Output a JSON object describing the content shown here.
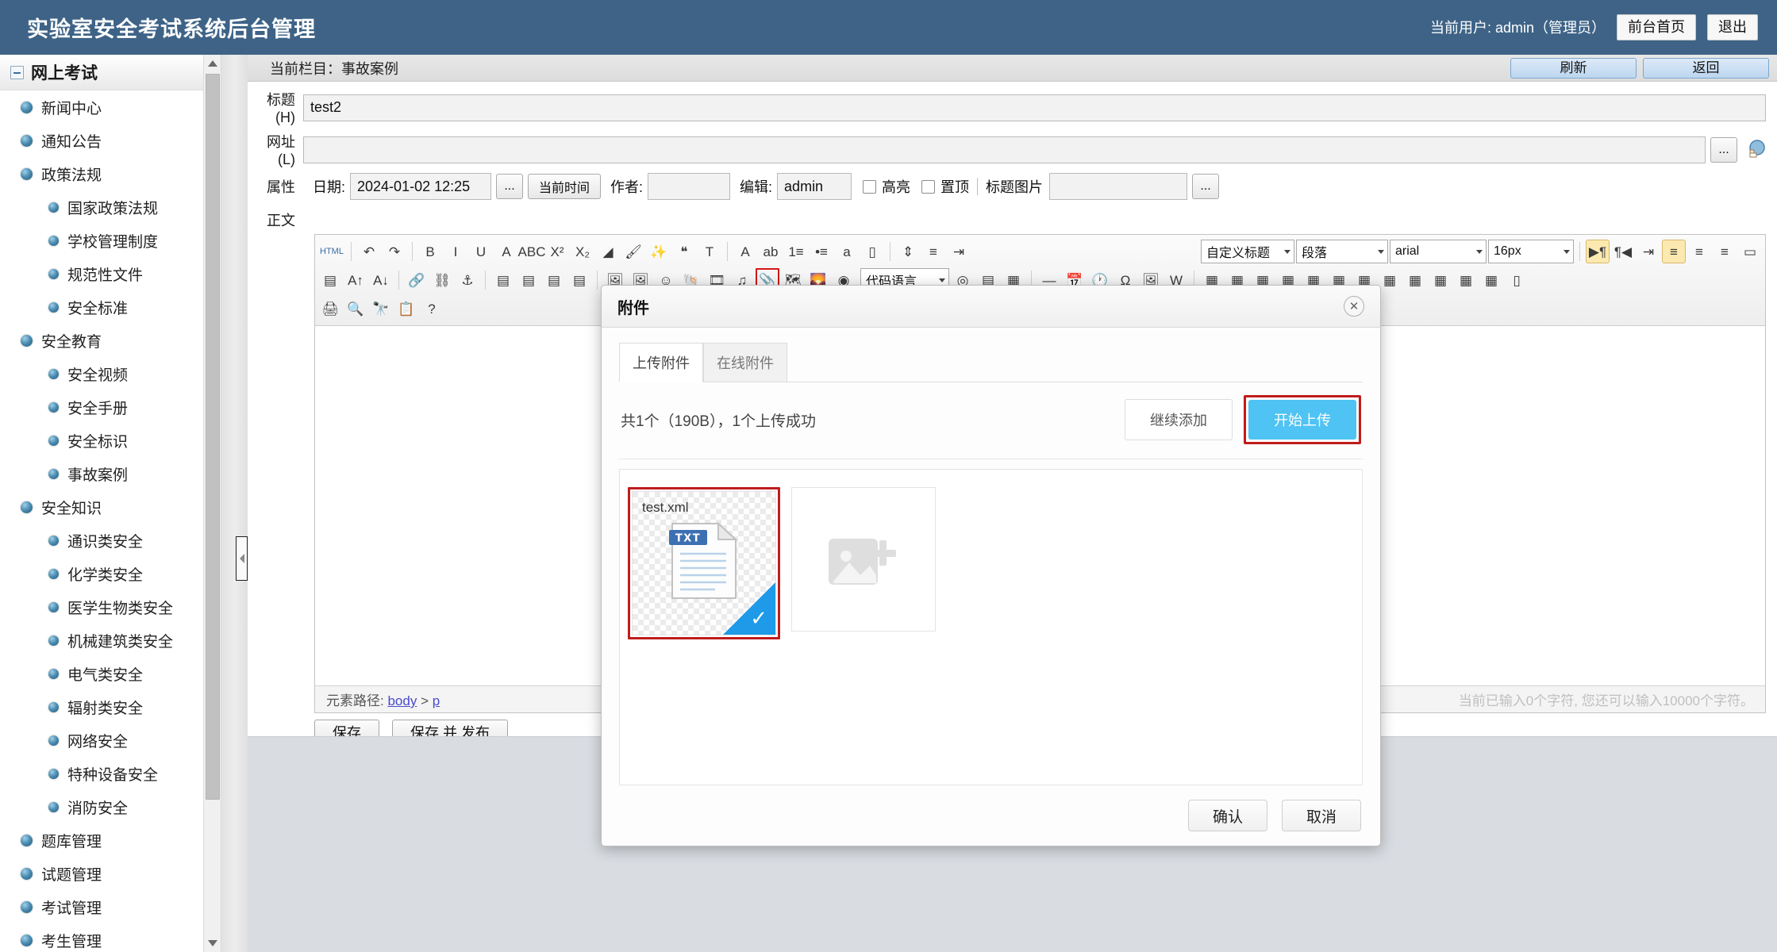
{
  "header": {
    "title": "实验室安全考试系统后台管理",
    "current_user": "当前用户: admin（管理员）",
    "frontend_button": "前台首页",
    "logout_button": "退出",
    "background_color": "#3e6387"
  },
  "sidebar": {
    "root_label": "网上考试",
    "items": [
      {
        "label": "新闻中心",
        "level": 1
      },
      {
        "label": "通知公告",
        "level": 1
      },
      {
        "label": "政策法规",
        "level": 1
      },
      {
        "label": "国家政策法规",
        "level": 2
      },
      {
        "label": "学校管理制度",
        "level": 2
      },
      {
        "label": "规范性文件",
        "level": 2
      },
      {
        "label": "安全标准",
        "level": 2
      },
      {
        "label": "安全教育",
        "level": 1
      },
      {
        "label": "安全视频",
        "level": 2
      },
      {
        "label": "安全手册",
        "level": 2
      },
      {
        "label": "安全标识",
        "level": 2
      },
      {
        "label": "事故案例",
        "level": 2
      },
      {
        "label": "安全知识",
        "level": 1
      },
      {
        "label": "通识类安全",
        "level": 2
      },
      {
        "label": "化学类安全",
        "level": 2
      },
      {
        "label": "医学生物类安全",
        "level": 2
      },
      {
        "label": "机械建筑类安全",
        "level": 2
      },
      {
        "label": "电气类安全",
        "level": 2
      },
      {
        "label": "辐射类安全",
        "level": 2
      },
      {
        "label": "网络安全",
        "level": 2
      },
      {
        "label": "特种设备安全",
        "level": 2
      },
      {
        "label": "消防安全",
        "level": 2
      },
      {
        "label": "题库管理",
        "level": 1
      },
      {
        "label": "试题管理",
        "level": 1
      },
      {
        "label": "考试管理",
        "level": 1
      },
      {
        "label": "考生管理",
        "level": 1
      }
    ]
  },
  "breadcrumb": {
    "text": "当前栏目：事故案例",
    "refresh_button": "刷新",
    "back_button": "返回"
  },
  "form": {
    "title_label": "标题(H)",
    "title_value": "test2",
    "url_label": "网址(L)",
    "url_value": "",
    "url_browse_button": "...",
    "attr_label": "属性",
    "date_label": "日期:",
    "date_value": "2024-01-02 12:25",
    "date_browse_button": "...",
    "now_button": "当前时间",
    "author_label": "作者:",
    "author_value": "",
    "editor_label": "编辑:",
    "editor_value": "admin",
    "highlight_label": "高亮",
    "top_label": "置顶",
    "title_image_label": "标题图片",
    "title_image_value": "",
    "title_image_browse_button": "...",
    "content_label": "正文"
  },
  "editor": {
    "toolbar_row1": [
      {
        "name": "html-source",
        "glyph": "HTML"
      },
      {
        "name": "sep"
      },
      {
        "name": "undo",
        "glyph": "↶"
      },
      {
        "name": "redo",
        "glyph": "↷"
      },
      {
        "name": "sep"
      },
      {
        "name": "bold",
        "glyph": "B"
      },
      {
        "name": "italic",
        "glyph": "I"
      },
      {
        "name": "underline",
        "glyph": "U"
      },
      {
        "name": "border",
        "glyph": "A"
      },
      {
        "name": "strikethrough",
        "glyph": "ABC"
      },
      {
        "name": "superscript",
        "glyph": "X²"
      },
      {
        "name": "subscript",
        "glyph": "X₂"
      },
      {
        "name": "remove-format",
        "glyph": "◢"
      },
      {
        "name": "paint-format",
        "glyph": "🖌"
      },
      {
        "name": "auto-format",
        "glyph": "✨"
      },
      {
        "name": "blockquote",
        "glyph": "❝"
      },
      {
        "name": "paste-text",
        "glyph": "T"
      },
      {
        "name": "sep"
      },
      {
        "name": "font-color",
        "glyph": "A"
      },
      {
        "name": "back-color",
        "glyph": "ab"
      },
      {
        "name": "ordered-list",
        "glyph": "1≡"
      },
      {
        "name": "unordered-list",
        "glyph": "•≡"
      },
      {
        "name": "anchor-link",
        "glyph": "a"
      },
      {
        "name": "page-break",
        "glyph": "▯"
      },
      {
        "name": "sep"
      },
      {
        "name": "line-height",
        "glyph": "⇕"
      },
      {
        "name": "paragraph-spacing",
        "glyph": "≡"
      },
      {
        "name": "indent-spacing",
        "glyph": "⇥"
      }
    ],
    "select_heading": "自定义标题",
    "select_paragraph": "段落",
    "select_font": "arial",
    "select_fontsize": "16px",
    "toolbar_row1_right": [
      {
        "name": "direction-ltr",
        "glyph": "▶¶",
        "active": true
      },
      {
        "name": "direction-rtl",
        "glyph": "¶◀"
      },
      {
        "name": "indent",
        "glyph": "⇥"
      },
      {
        "name": "align-left",
        "glyph": "≡",
        "active": true
      },
      {
        "name": "align-center",
        "glyph": "≡"
      },
      {
        "name": "align-right",
        "glyph": "≡"
      },
      {
        "name": "fullscreen",
        "glyph": "▭"
      }
    ],
    "toolbar_row2": [
      {
        "name": "justify",
        "glyph": "▤"
      },
      {
        "name": "increase-font",
        "glyph": "A↑"
      },
      {
        "name": "decrease-font",
        "glyph": "A↓"
      },
      {
        "name": "sep"
      },
      {
        "name": "insert-link",
        "glyph": "🔗"
      },
      {
        "name": "unlink",
        "glyph": "⛓"
      },
      {
        "name": "anchor",
        "glyph": "⚓"
      },
      {
        "name": "sep"
      },
      {
        "name": "image-left",
        "glyph": "▤"
      },
      {
        "name": "image-right",
        "glyph": "▤"
      },
      {
        "name": "image-center",
        "glyph": "▤"
      },
      {
        "name": "image-none",
        "glyph": "▤"
      },
      {
        "name": "sep"
      },
      {
        "name": "insert-image",
        "glyph": "🖼"
      },
      {
        "name": "image-manager",
        "glyph": "🖼"
      },
      {
        "name": "emotion",
        "glyph": "☺"
      },
      {
        "name": "seachart",
        "glyph": "🐚"
      },
      {
        "name": "insert-video",
        "glyph": "🎞"
      },
      {
        "name": "insert-music",
        "glyph": "♫"
      },
      {
        "name": "attachment",
        "glyph": "📎",
        "highlight": true
      },
      {
        "name": "map",
        "glyph": "🗺"
      },
      {
        "name": "gmap",
        "glyph": "🌄"
      },
      {
        "name": "webapp",
        "glyph": "◉"
      }
    ],
    "select_codelang": "代码语言",
    "toolbar_row2_right": [
      {
        "name": "snapscreen",
        "glyph": "◎"
      },
      {
        "name": "template",
        "glyph": "▤"
      },
      {
        "name": "background",
        "glyph": "▦"
      },
      {
        "name": "sep"
      },
      {
        "name": "horizontal-rule",
        "glyph": "—"
      },
      {
        "name": "date",
        "glyph": "📅"
      },
      {
        "name": "time",
        "glyph": "🕐"
      },
      {
        "name": "spechars",
        "glyph": "Ω"
      },
      {
        "name": "wordimage",
        "glyph": "🖼"
      },
      {
        "name": "word-paste",
        "glyph": "W"
      },
      {
        "name": "sep"
      },
      {
        "name": "insert-table",
        "glyph": "▦"
      },
      {
        "name": "delete-table",
        "glyph": "▦"
      },
      {
        "name": "table-props",
        "glyph": "▦"
      },
      {
        "name": "insert-row",
        "glyph": "▦"
      },
      {
        "name": "insert-col",
        "glyph": "▦"
      },
      {
        "name": "merge-cells",
        "glyph": "▦"
      },
      {
        "name": "split-cells",
        "glyph": "▦"
      },
      {
        "name": "table-sort",
        "glyph": "▦"
      },
      {
        "name": "table-border",
        "glyph": "▦"
      },
      {
        "name": "table-align",
        "glyph": "▦"
      },
      {
        "name": "table-extra",
        "glyph": "▦"
      },
      {
        "name": "table-misc",
        "glyph": "▦"
      },
      {
        "name": "note",
        "glyph": "▯"
      }
    ],
    "toolbar_row3": [
      {
        "name": "print",
        "glyph": "🖨"
      },
      {
        "name": "preview",
        "glyph": "🔍"
      },
      {
        "name": "search-replace",
        "glyph": "🔭"
      },
      {
        "name": "clipboard",
        "glyph": "📋"
      },
      {
        "name": "help",
        "glyph": "?"
      }
    ],
    "element_path_label": "元素路径:",
    "element_path_body": "body",
    "element_path_sep": ">",
    "element_path_p": "p",
    "char_count": "当前已输入0个字符, 您还可以输入10000个字符。"
  },
  "actions": {
    "save_button": "保存",
    "save_publish_button": "保存 并 发布"
  },
  "modal": {
    "title": "附件",
    "close_icon": "✕",
    "tabs": [
      {
        "label": "上传附件",
        "active": true
      },
      {
        "label": "在线附件",
        "active": false
      }
    ],
    "upload_status": "共1个（190B），1个上传成功",
    "continue_button": "继续添加",
    "start_upload_button": "开始上传",
    "start_upload_color": "#4fc3f3",
    "highlight_color": "#c01c1c",
    "files": [
      {
        "name": "test.xml",
        "badge": "TXT",
        "status": "success"
      }
    ],
    "add_placeholder_icon": "add-image-icon",
    "confirm_button": "确认",
    "cancel_button": "取消"
  }
}
